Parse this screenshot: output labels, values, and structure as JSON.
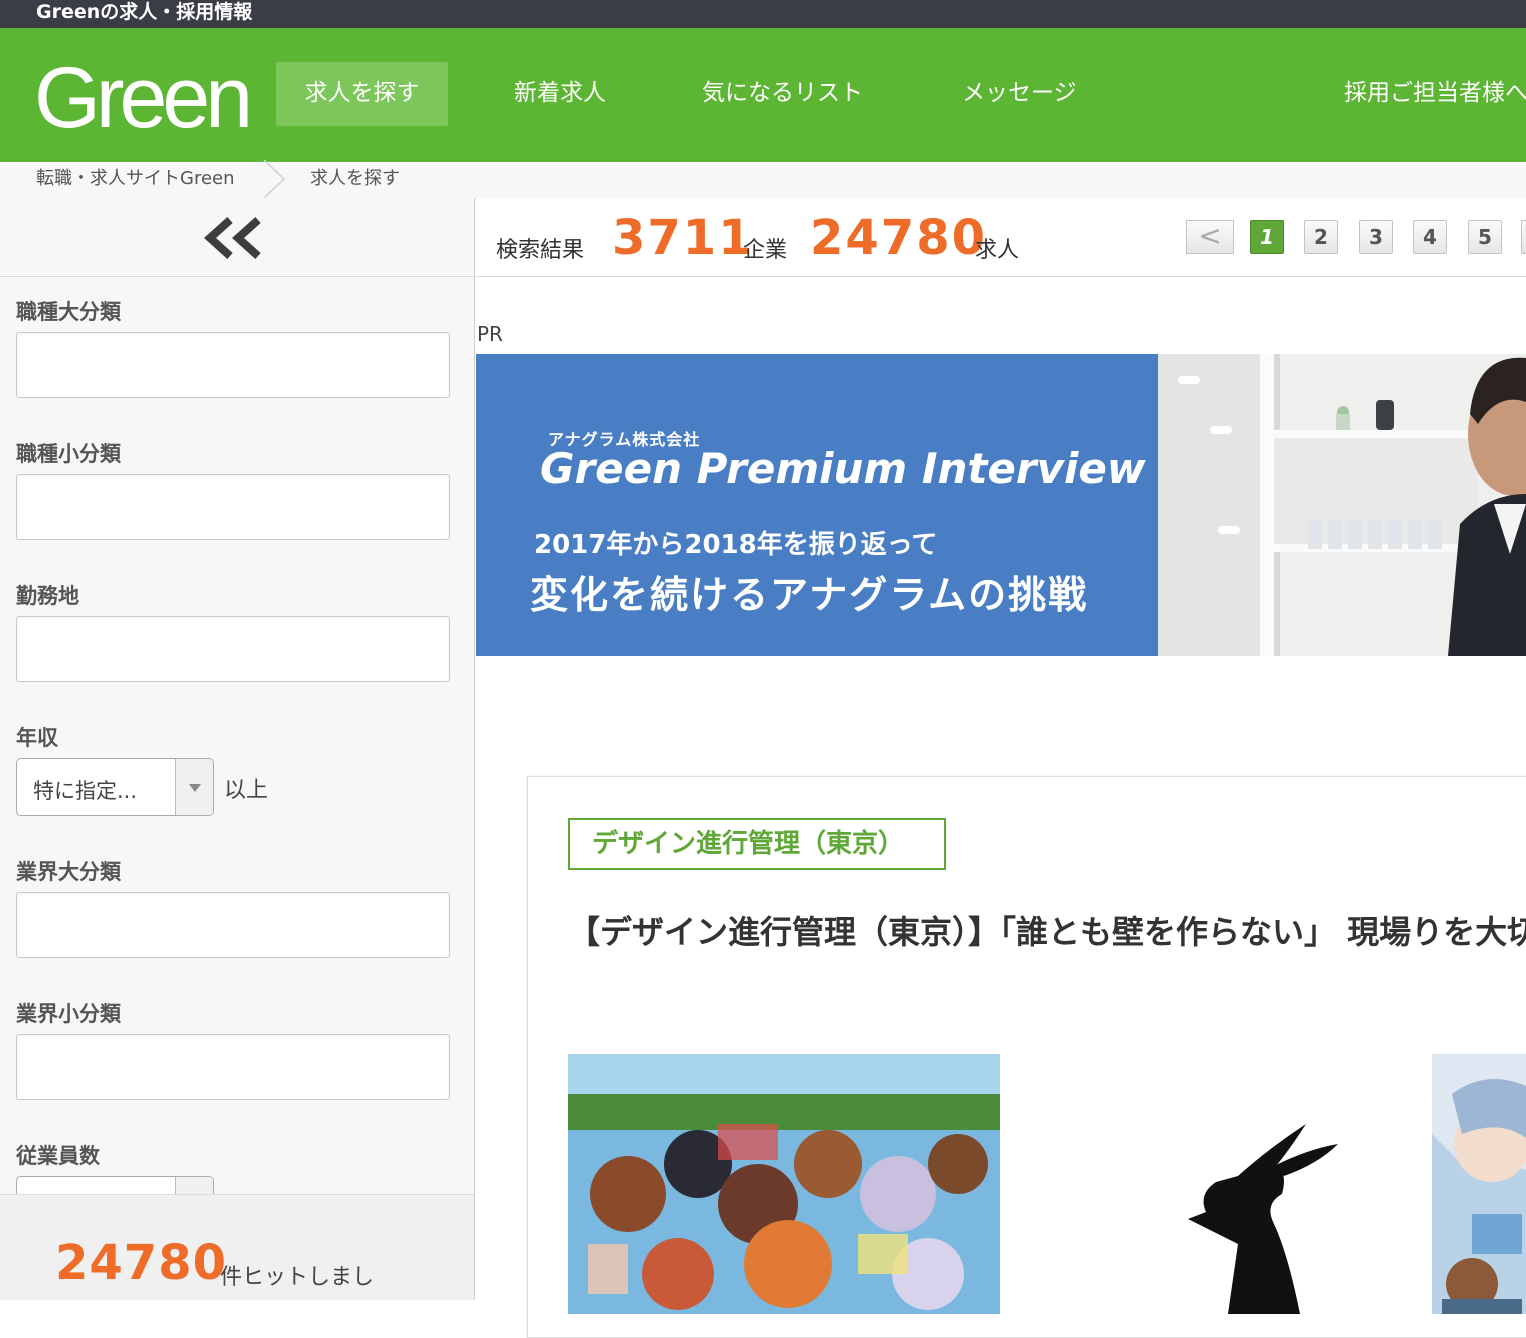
{
  "topbar": {
    "title": "Greenの求人・採用情報"
  },
  "header": {
    "logo": "Green",
    "nav": [
      {
        "label": "求人を探す",
        "active": true
      },
      {
        "label": "新着求人",
        "active": false
      },
      {
        "label": "気になるリスト",
        "active": false
      },
      {
        "label": "メッセージ",
        "active": false
      },
      {
        "label": "採用ご担当者様へ",
        "active": false
      }
    ]
  },
  "breadcrumb": [
    "転職・求人サイトGreen",
    "求人を探す"
  ],
  "sidebar": {
    "collapse_icon": "double-chevron-left-icon",
    "filters": [
      {
        "label": "職種大分類",
        "value": ""
      },
      {
        "label": "職種小分類",
        "value": ""
      },
      {
        "label": "勤務地",
        "value": ""
      },
      {
        "label": "年収",
        "selected": "特に指定...",
        "suffix": "以上"
      },
      {
        "label": "業界大分類",
        "value": ""
      },
      {
        "label": "業界小分類",
        "value": ""
      },
      {
        "label": "従業員数",
        "value": ""
      }
    ],
    "hit_count": "24780",
    "hit_text": "件ヒットしまし"
  },
  "results": {
    "label": "検索結果",
    "company_count": "3711",
    "company_label": "企業",
    "job_count": "24780",
    "job_label": "求人",
    "pagination": {
      "prev": "<",
      "pages": [
        "1",
        "2",
        "3",
        "4",
        "5"
      ],
      "current": "1"
    }
  },
  "pr": {
    "label": "PR",
    "banner": {
      "company": "アナグラム株式会社",
      "title": "Green Premium Interview",
      "subtitle": "2017年から2018年を振り返って",
      "headline": "変化を続けるアナグラムの挑戦"
    }
  },
  "job": {
    "tag": "デザイン進行管理（東京）",
    "title": "【デザイン進行管理（東京）】「誰とも壁を作らない」 現場りを大切に"
  },
  "colors": {
    "brand_green": "#5db534",
    "accent_orange": "#ee6b28",
    "banner_blue": "#4a7ec4",
    "topbar": "#3a3d45"
  }
}
